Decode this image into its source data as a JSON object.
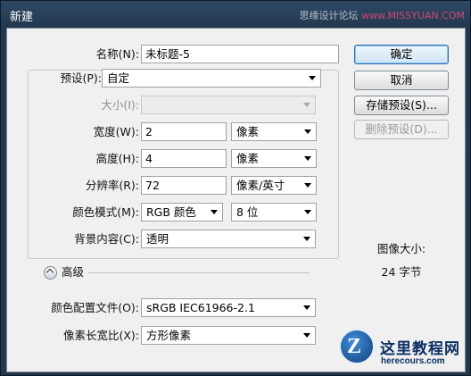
{
  "window": {
    "title": "新建",
    "watermark_text_a": "思缘设计论坛 ",
    "watermark_text_b": "www.MISSYUAN.COM"
  },
  "form": {
    "name_label": "名称(N):",
    "name_value": "未标题-5",
    "preset_label": "预设(P):",
    "preset_value": "自定",
    "size_label": "大小(I):",
    "size_value": "",
    "width_label": "宽度(W):",
    "width_value": "2",
    "width_unit": "像素",
    "height_label": "高度(H):",
    "height_value": "4",
    "height_unit": "像素",
    "resolution_label": "分辨率(R):",
    "resolution_value": "72",
    "resolution_unit": "像素/英寸",
    "colormode_label": "颜色模式(M):",
    "colormode_value": "RGB 颜色",
    "bitdepth_value": "8 位",
    "background_label": "背景内容(C):",
    "background_value": "透明",
    "advanced_label": "高级",
    "profile_label": "颜色配置文件(O):",
    "profile_value": "sRGB IEC61966-2.1",
    "aspect_label": "像素长宽比(X):",
    "aspect_value": "方形像素"
  },
  "buttons": {
    "ok": "确定",
    "cancel": "取消",
    "save_preset": "存储预设(S)...",
    "delete_preset": "删除预设(D)..."
  },
  "image_size": {
    "title": "图像大小:",
    "value": "24 字节"
  },
  "badge": {
    "letter": "Z",
    "name": "这里教程网",
    "url": "herecours.com"
  }
}
